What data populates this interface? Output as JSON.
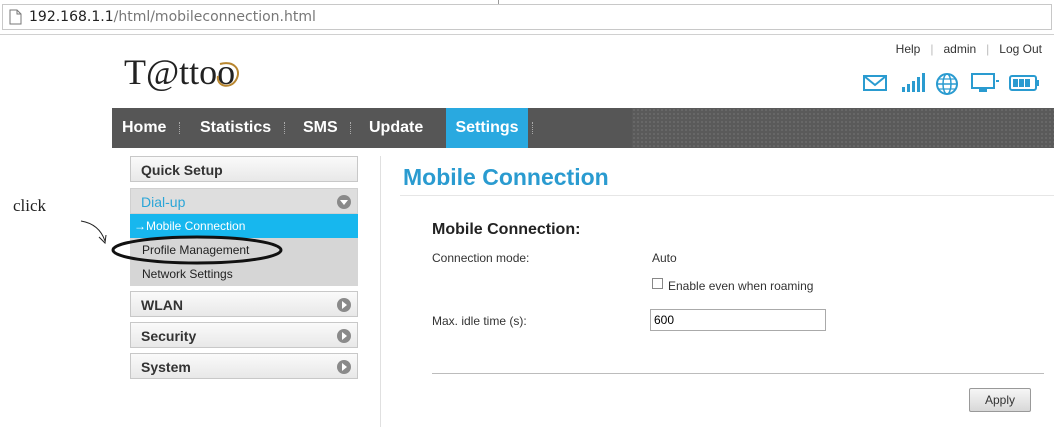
{
  "browser": {
    "url_host": "192.168.1.1",
    "url_path": "/html/mobileconnection.html",
    "page_icon": "page-icon"
  },
  "header": {
    "logo_text": "T@ttoo",
    "links": {
      "help": "Help",
      "user": "admin",
      "logout": "Log Out"
    },
    "status_icons": [
      "mail-icon",
      "signal-bars-icon",
      "globe-icon",
      "computer-icon",
      "battery-icon"
    ]
  },
  "nav": {
    "items": [
      {
        "label": "Home"
      },
      {
        "label": "Statistics"
      },
      {
        "label": "SMS"
      },
      {
        "label": "Update"
      },
      {
        "label": "Settings",
        "active": true
      }
    ]
  },
  "sidebar": {
    "quick_setup": "Quick Setup",
    "dialup": "Dial-up",
    "dialup_items": [
      "→Mobile Connection",
      "Profile Management",
      "Network Settings"
    ],
    "wlan": "WLAN",
    "security": "Security",
    "system": "System"
  },
  "content": {
    "page_title": "Mobile Connection",
    "section_title": "Mobile Connection:",
    "connection_mode_label": "Connection mode:",
    "connection_mode_value": "Auto",
    "roaming_label": "Enable even when roaming",
    "idle_label": "Max. idle time (s):",
    "idle_value": "600",
    "apply_label": "Apply"
  },
  "annotation": {
    "text": "click"
  },
  "colors": {
    "accent": "#29a9e0",
    "nav_bg": "#565656",
    "active_sub": "#17b7ee",
    "title": "#2a9bd0"
  }
}
